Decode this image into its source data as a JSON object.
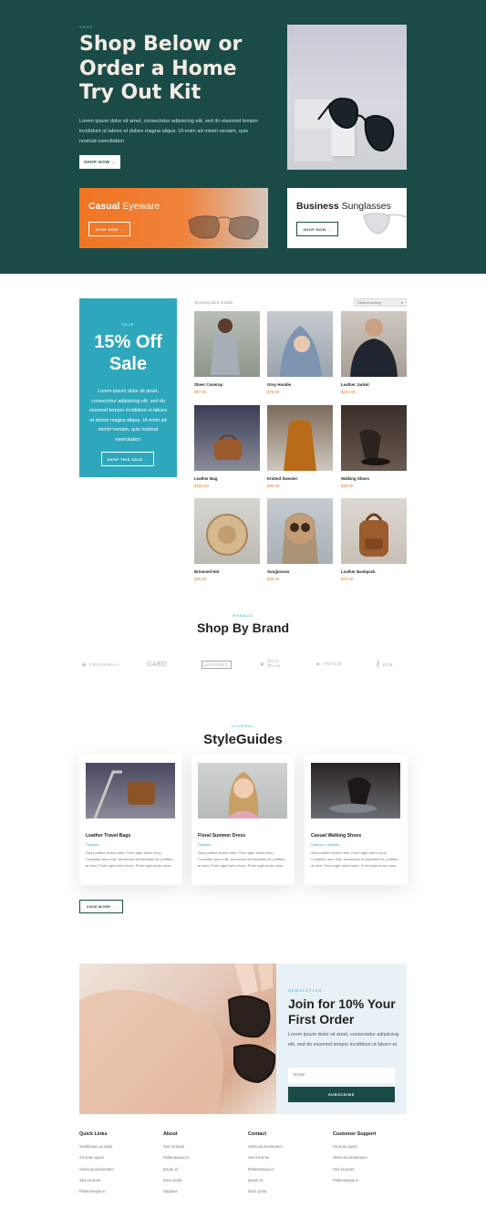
{
  "hero": {
    "eyebrow": "SHOP",
    "title": "Shop Below or Order a Home Try Out Kit",
    "lead": "Lorem ipsum dolor sit amet, consectetur adipiscing elit, sed do eiusmod tempor incididunt ut labore et dolore magna aliqua. Ut enim ad minim veniam, quis nostrud exercitation",
    "button": "SHOP NOW",
    "arrow": "→"
  },
  "promos": [
    {
      "title_bold": "Casual",
      "title_light": " Eyeware",
      "button": "SHOP NOW →"
    },
    {
      "title_bold": "Business",
      "title_light": " Sunglasses",
      "button": "SHOP NOW →"
    }
  ],
  "sale": {
    "tag": "SALE",
    "title": "15% Off Sale",
    "text": "Lorem ipsum dolor sit amet, consectetur adipiscing elit, sed do eiusmod tempor incididunt ut labore et dolore magna aliqua. Ut enim ad minim veniam, quis nostrud exercitation",
    "button": "SHOP THIS SALE →"
  },
  "shop": {
    "showing": "Showing all 9 results",
    "sorting": "Default sorting",
    "products": [
      {
        "name": "Sheer Coverup",
        "price": "$67.00"
      },
      {
        "name": "Grey Hoodie",
        "price": "$78.00"
      },
      {
        "name": "Leather Jacket",
        "price": "$230.00"
      },
      {
        "name": "Leather Bag",
        "price": "$150.00"
      },
      {
        "name": "Knitted Sweater",
        "price": "$80.00"
      },
      {
        "name": "Walking Shoes",
        "price": "$49.00"
      },
      {
        "name": "Brimmed Hat",
        "price": "$25.00"
      },
      {
        "name": "Sunglasses",
        "price": "$35.00"
      },
      {
        "name": "Leather Backpack",
        "price": "$70.00"
      }
    ]
  },
  "brands": {
    "tag": "BRANDS",
    "title": "Shop By Brand",
    "logos": [
      "CROSSWALL",
      "GABO",
      "LOGONEO",
      "Bird Wave",
      "INNER",
      "DCB"
    ]
  },
  "styleguides": {
    "tag": "JOURNAL",
    "title": "StyleGuides",
    "cards": [
      {
        "title": "Leather Travel Bags",
        "category": "Fashion",
        "excerpt": "Sed porttitor lectus nibh. Proin eget tortor risus. Curabitur arcu erat, accumsan id imperdiet et, porttitor at sem. Proin eget tortor risus. Proin eget tortor risus."
      },
      {
        "title": "Floral Summer Dress",
        "category": "Fashion",
        "excerpt": "Sed porttitor lectus nibh. Proin eget tortor risus. Curabitur arcu erat, accumsan id imperdiet et, porttitor at sem. Proin eget tortor risus. Proin eget tortor risus."
      },
      {
        "title": "Casual Walking Shoes",
        "category": "Fashion, Lifestyle",
        "excerpt": "Sed porttitor lectus nibh. Proin eget tortor risus. Curabitur arcu erat, accumsan id imperdiet et, porttitor at sem. Proin eget tortor risus. Proin eget tortor risus."
      }
    ],
    "view_more": "VIEW MORE →"
  },
  "newsletter": {
    "tag": "NEWSLETTER",
    "title": "Join for 10% Your First Order",
    "text": "Lorem ipsum dolor sit amet, consectetur adipiscing elit, sed do eiusmod tempor incididunt ut labore et.",
    "email_placeholder": "Email",
    "subscribe": "SUBSCRIBE"
  },
  "footer": [
    {
      "heading": "Quick Links",
      "links": [
        "Vestibulum ac diam",
        "Sit amet quam",
        "Vehicula elementum",
        "Sed sit amet",
        "Pellentesque in"
      ]
    },
    {
      "heading": "About",
      "links": [
        "Sed sit amet",
        "Pellentesque in",
        "Ipsum id",
        "Donc porta",
        "Dapibus"
      ]
    },
    {
      "heading": "Contact",
      "links": [
        "Vehicula elementum",
        "Sed sit amet",
        "Pellentesque in",
        "Ipsum id",
        "Donc porta"
      ]
    },
    {
      "heading": "Customer Support",
      "links": [
        "Sit amet quam",
        "Vehicula elementum",
        "Sed sit amet",
        "Pellentesque in"
      ]
    }
  ]
}
